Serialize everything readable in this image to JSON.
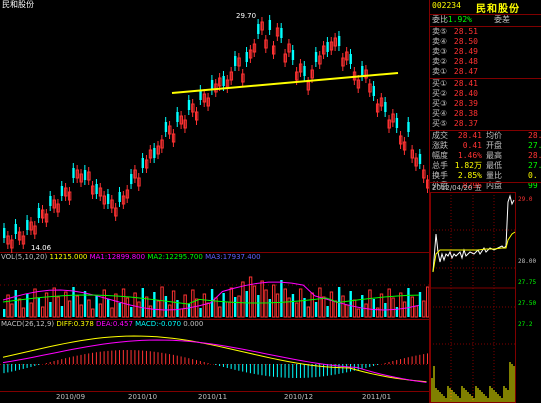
{
  "window": {
    "title": "民和股份"
  },
  "kline": {
    "high_label": "29.70",
    "low_label": "14.06",
    "x_axis": [
      "2010/09",
      "2010/10",
      "2010/11",
      "2010/12",
      "2011/01"
    ],
    "vol_indicator": {
      "name": "VOL(5,10,20)",
      "value": "11215.000",
      "ma1": "MA1:12899.800",
      "ma2": "MA2:12295.700",
      "ma3": "MA3:17937.400"
    },
    "macd_indicator": {
      "name": "MACD(26,12,9)",
      "diff": "DIFF:0.378",
      "dea": "DEA:0.457",
      "macd": "MACD:-0.070",
      "extra": "0.000"
    }
  },
  "chart_data": {
    "type": "candlestick",
    "trendline_color": "#ffff00",
    "up_color": "#ff3232",
    "down_color": "#00ffff",
    "x_labels": [
      "2010/09",
      "2010/10",
      "2010/11",
      "2010/12",
      "2011/01"
    ],
    "price_high": 29.7,
    "price_low": 14.06
  },
  "quote": {
    "code": "002234",
    "name": "民和股份",
    "weibi_label": "委比",
    "weibi": "-1.92%",
    "weicha_label": "委差",
    "weicha": "-",
    "asks": [
      {
        "label": "卖⑤",
        "price": "28.51",
        "vol": "-"
      },
      {
        "label": "卖④",
        "price": "28.50",
        "vol": "-"
      },
      {
        "label": "卖③",
        "price": "28.49",
        "vol": "-"
      },
      {
        "label": "卖②",
        "price": "28.48",
        "vol": "-"
      },
      {
        "label": "卖①",
        "price": "28.47",
        "vol": "-"
      }
    ],
    "bids": [
      {
        "label": "买①",
        "price": "28.41",
        "vol": "-"
      },
      {
        "label": "买②",
        "price": "28.40",
        "vol": "-"
      },
      {
        "label": "买③",
        "price": "28.39",
        "vol": "-"
      },
      {
        "label": "买④",
        "price": "28.38",
        "vol": "-"
      },
      {
        "label": "买⑤",
        "price": "28.37",
        "vol": "-"
      }
    ],
    "stats": [
      {
        "l1": "成交",
        "v1": "28.41",
        "l2": "均价",
        "v2": "28.3"
      },
      {
        "l1": "涨跌",
        "v1": "0.41",
        "l2": "开盘",
        "v2": "27.7"
      },
      {
        "l1": "幅度",
        "v1": "1.46%",
        "l2": "最高",
        "v2": "28.6"
      },
      {
        "l1": "总手",
        "v1": "1.82万",
        "l2": "最低",
        "v2": "27.7"
      },
      {
        "l1": "换手",
        "v1": "2.85%",
        "l2": "量比",
        "v2": "0."
      },
      {
        "l1": "外盘",
        "v1": "8296",
        "l2": "内盘",
        "v2": "99"
      }
    ],
    "intraday_date": "2012/04/20 五",
    "intraday_axis": [
      "29.0",
      "28.00",
      "27.75",
      "27.50",
      "27.2"
    ]
  }
}
